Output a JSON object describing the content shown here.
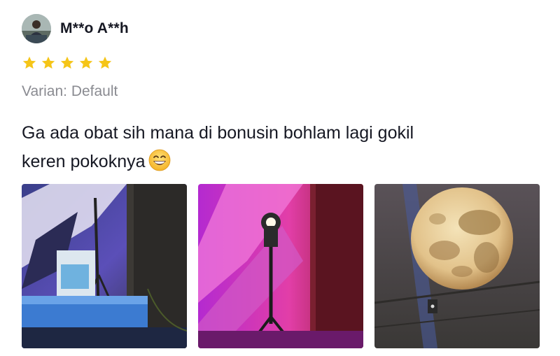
{
  "review": {
    "username": "M**o A**h",
    "rating": 5,
    "rating_max": 5,
    "star_icon": "star-icon",
    "star_color": "#f5c518",
    "variant_text": "Varian: Default",
    "text_line1": "Ga ada obat sih mana di bonusin bohlam lagi gokil",
    "text_line2": "keren pokoknya",
    "emoji_icon": "grinning-face-emoji-icon",
    "photos": [
      {
        "name": "review-photo-1",
        "subject": "lamp-on-table"
      },
      {
        "name": "review-photo-2",
        "subject": "spotlight-pink-wall"
      },
      {
        "name": "review-photo-3",
        "subject": "moon-projection"
      }
    ]
  },
  "colors": {
    "text_primary": "#161823",
    "text_secondary": "#8a8b91"
  }
}
